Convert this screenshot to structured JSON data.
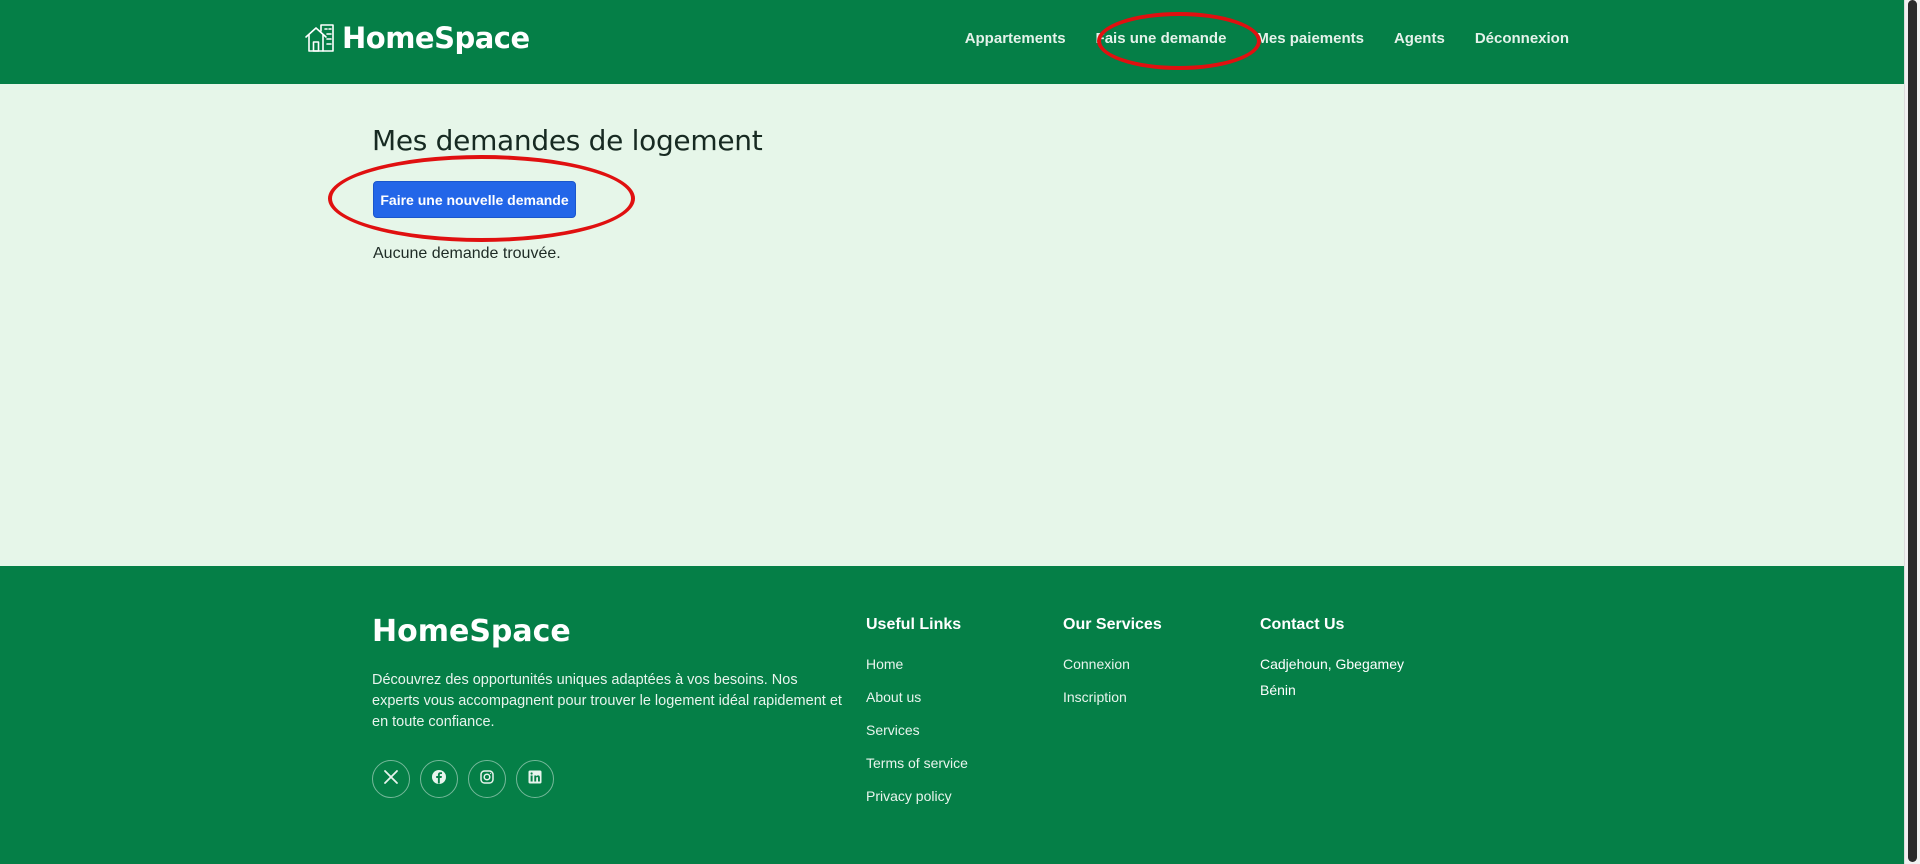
{
  "header": {
    "brand": "HomeSpace",
    "nav": [
      {
        "label": "Appartements"
      },
      {
        "label": "Fais une demande"
      },
      {
        "label": "Mes paiements"
      },
      {
        "label": "Agents"
      },
      {
        "label": "Déconnexion"
      }
    ]
  },
  "main": {
    "title": "Mes demandes de logement",
    "new_request_button": "Faire une nouvelle demande",
    "empty_message": "Aucune demande trouvée."
  },
  "footer": {
    "brand": "HomeSpace",
    "description": "Découvrez des opportunités uniques adaptées à vos besoins. Nos experts vous accompagnent pour trouver le logement idéal rapidement et en toute confiance.",
    "socials": [
      {
        "icon": "x-twitter-icon"
      },
      {
        "icon": "facebook-icon"
      },
      {
        "icon": "instagram-icon"
      },
      {
        "icon": "linkedin-icon"
      }
    ],
    "useful_links": {
      "heading": "Useful Links",
      "items": [
        "Home",
        "About us",
        "Services",
        "Terms of service",
        "Privacy policy"
      ]
    },
    "services": {
      "heading": "Our Services",
      "items": [
        "Connexion",
        "Inscription"
      ]
    },
    "contact": {
      "heading": "Contact Us",
      "lines": [
        "Cadjehoun, Gbegamey",
        "Bénin"
      ]
    }
  },
  "colors": {
    "brand_green": "#057f47",
    "main_background": "#e6f6e9",
    "primary_button": "#2366e8",
    "annotation_red": "#e01010"
  }
}
